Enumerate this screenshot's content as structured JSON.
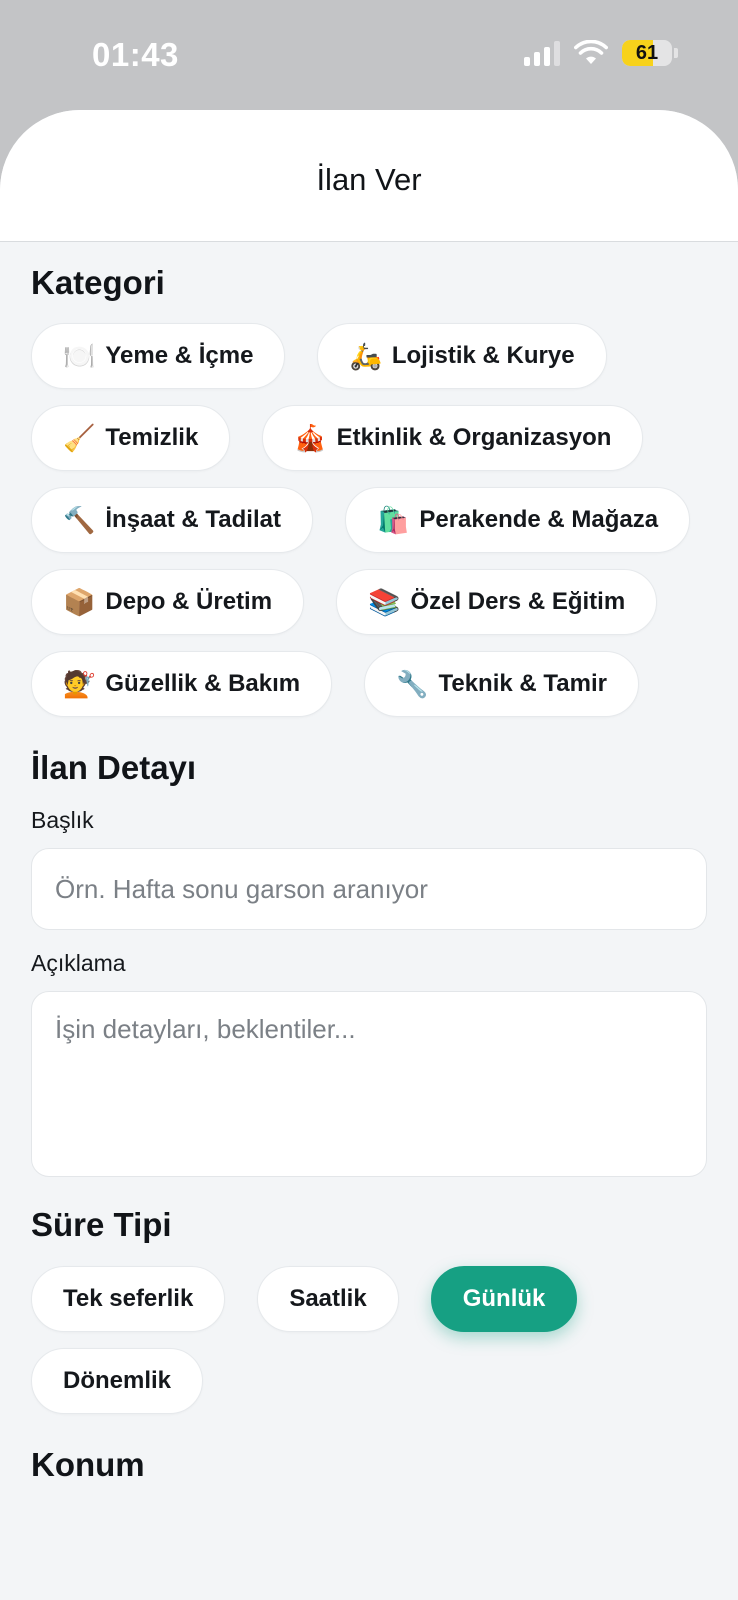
{
  "status_bar": {
    "time": "01:43",
    "battery": "61",
    "battery_level_percent": 61
  },
  "header": {
    "title": "İlan Ver"
  },
  "category": {
    "title": "Kategori",
    "items": [
      {
        "emoji": "🍽️",
        "label": "Yeme & İçme",
        "icon": "plate-cutlery-icon"
      },
      {
        "emoji": "🛵",
        "label": "Lojistik & Kurye",
        "icon": "scooter-icon"
      },
      {
        "emoji": "🧹",
        "label": "Temizlik",
        "icon": "broom-icon"
      },
      {
        "emoji": "🎪",
        "label": "Etkinlik & Organizasyon",
        "icon": "circus-tent-icon"
      },
      {
        "emoji": "🔨",
        "label": "İnşaat & Tadilat",
        "icon": "hammer-icon"
      },
      {
        "emoji": "🛍️",
        "label": "Perakende & Mağaza",
        "icon": "shopping-bags-icon"
      },
      {
        "emoji": "📦",
        "label": "Depo & Üretim",
        "icon": "package-icon"
      },
      {
        "emoji": "📚",
        "label": "Özel Ders & Eğitim",
        "icon": "books-icon"
      },
      {
        "emoji": "💇",
        "label": "Güzellik & Bakım",
        "icon": "haircut-icon"
      },
      {
        "emoji": "🔧",
        "label": "Teknik & Tamir",
        "icon": "wrench-icon"
      }
    ]
  },
  "details": {
    "title": "İlan Detayı",
    "title_field": {
      "label": "Başlık",
      "value": "",
      "placeholder": "Örn. Hafta sonu garson aranıyor"
    },
    "description_field": {
      "label": "Açıklama",
      "value": "",
      "placeholder": "İşin detayları, beklentiler..."
    }
  },
  "duration": {
    "title": "Süre Tipi",
    "selected": "Günlük",
    "options": [
      "Tek seferlik",
      "Saatlik",
      "Günlük",
      "Dönemlik"
    ]
  },
  "location": {
    "title": "Konum"
  },
  "colors": {
    "accent": "#16a083",
    "sheet_background": "#f3f5f7",
    "status_bar_background": "#c3c4c6",
    "battery": "#f7d21b"
  }
}
